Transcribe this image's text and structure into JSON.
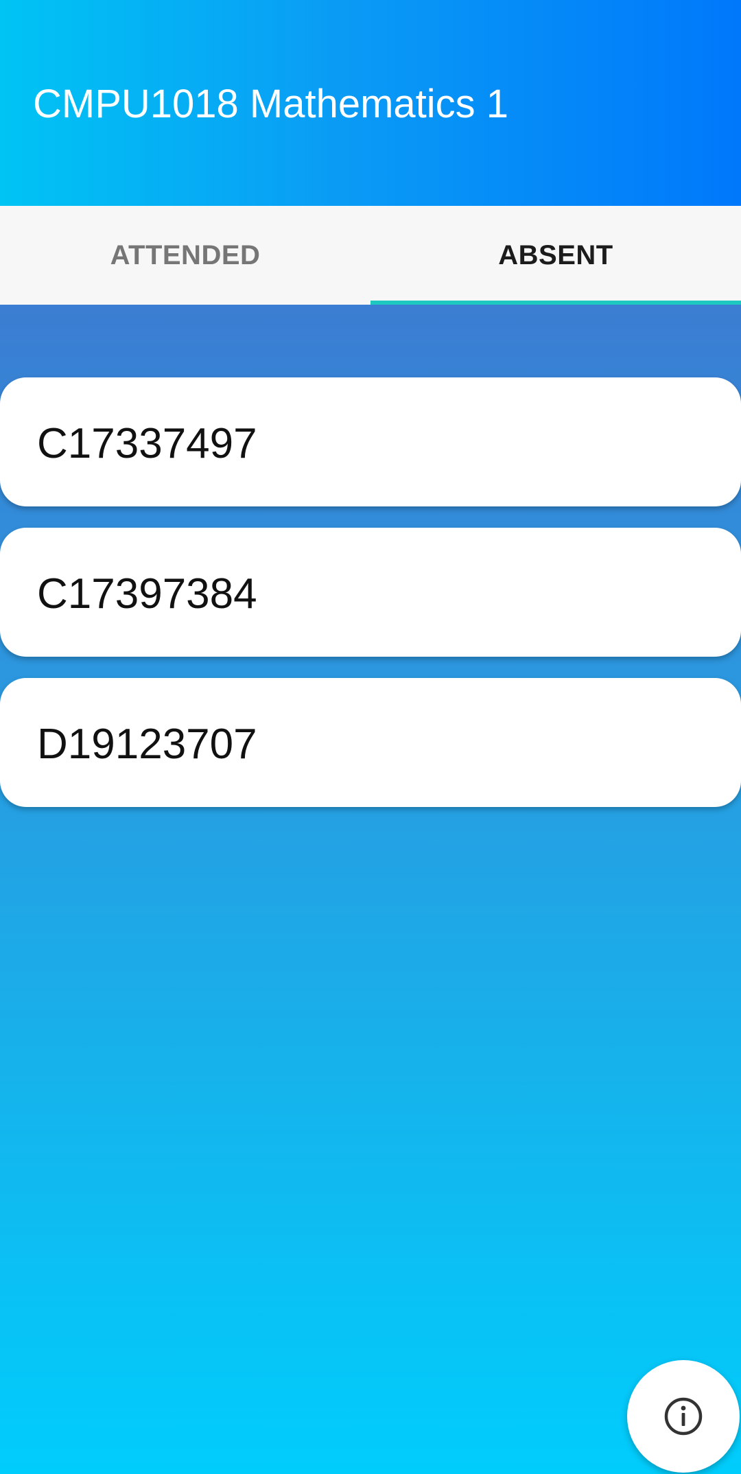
{
  "app_bar": {
    "title": "CMPU1018 Mathematics 1"
  },
  "tabs": [
    {
      "label": "ATTENDED",
      "selected": false
    },
    {
      "label": "ABSENT",
      "selected": true
    }
  ],
  "absent_list": [
    {
      "student_id": "C17337497"
    },
    {
      "student_id": "C17397384"
    },
    {
      "student_id": "D19123707"
    }
  ],
  "fab": {
    "icon": "info-icon"
  },
  "colors": {
    "app_bar_start": "#00c4f4",
    "app_bar_end": "#0078fb",
    "tab_indicator": "#1ec8c0",
    "content_top": "#3b7dd2",
    "content_bottom": "#00cdfc"
  }
}
